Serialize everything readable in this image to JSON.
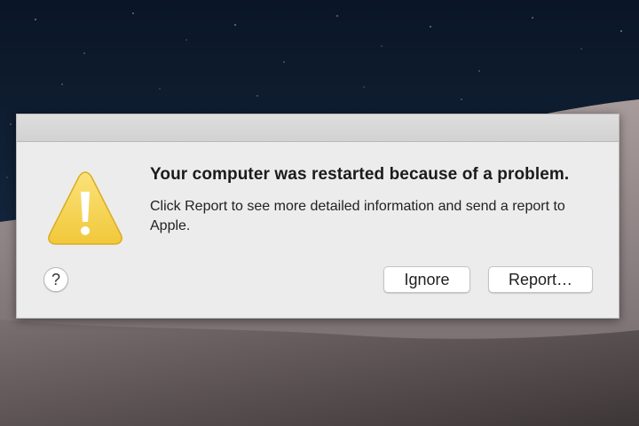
{
  "dialog": {
    "headline": "Your computer was restarted because of a problem.",
    "message": "Click Report to see more detailed information and send a report to Apple.",
    "icon": "caution-triangle-icon",
    "help_label": "?",
    "buttons": {
      "ignore_label": "Ignore",
      "report_label": "Report…"
    }
  },
  "colors": {
    "sky": "#0d1a2c",
    "dune": "#8f8485",
    "dialog_bg": "#ececec",
    "warning_yellow": "#f5d24a"
  }
}
